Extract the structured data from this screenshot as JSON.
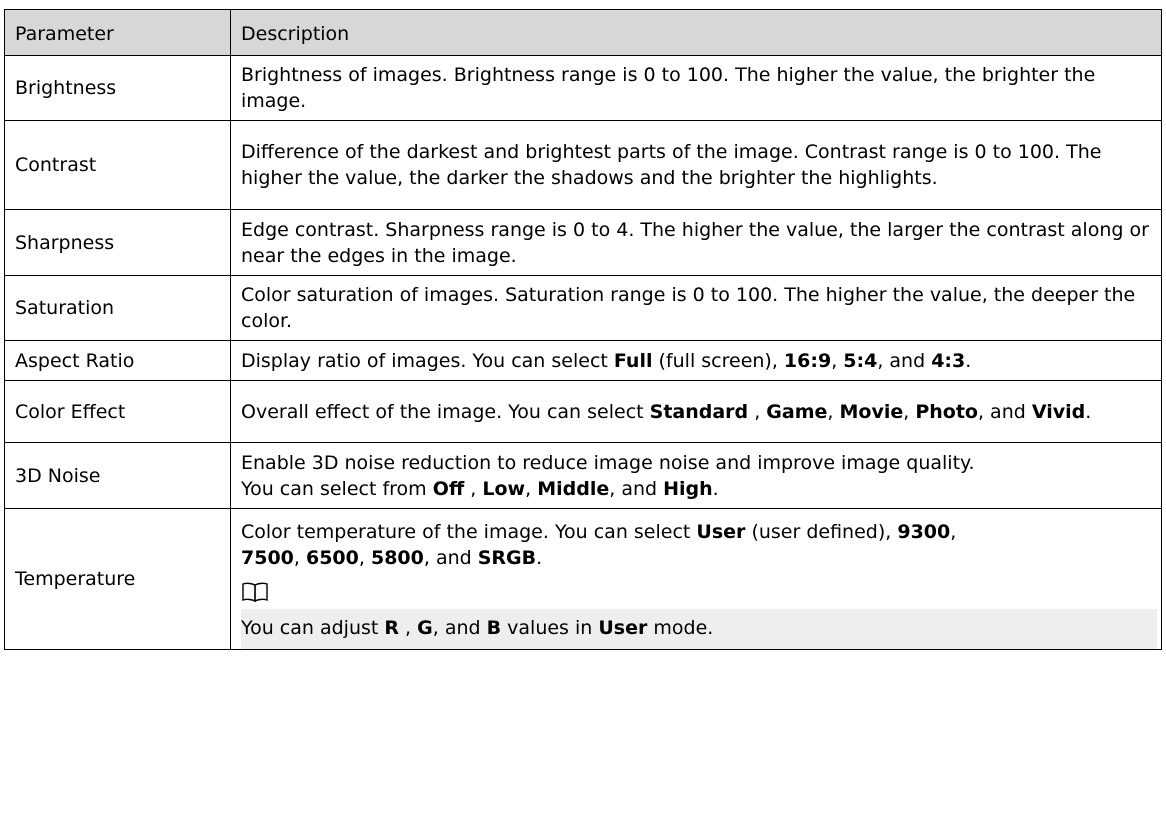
{
  "header": {
    "parameter": "Parameter",
    "description": "Description"
  },
  "rows": {
    "brightness": {
      "name": "Brightness",
      "desc": "Brightness of images. Brightness range is 0 to 100. The higher the value, the brighter the image."
    },
    "contrast": {
      "name": "Contrast",
      "desc": "Difference of the darkest and brightest parts of the image. Contrast range is 0 to 100. The higher the value, the darker the shadows and the brighter the highlights."
    },
    "sharpness": {
      "name": "Sharpness",
      "desc": "Edge contrast. Sharpness range is 0 to 4. The higher the value, the larger the contrast along or near the edges in the image."
    },
    "saturation": {
      "name": "Saturation",
      "desc": "Color saturation of images. Saturation range is 0 to 100. The higher the value, the deeper the color."
    },
    "aspect_ratio": {
      "name": "Aspect Ratio",
      "desc_prefix": "Display ratio of images. You can select ",
      "opt_full": "Full",
      "opt_full_note": " (full screen), ",
      "opt_169": "16:9",
      "sep1": ", ",
      "opt_54": "5:4",
      "sep2": ", and ",
      "opt_43": "4:3",
      "end": "."
    },
    "color_effect": {
      "name": "Color Effect",
      "desc_prefix": "Overall effect of the image. You can select ",
      "opt_standard": "Standard",
      "sep1": " , ",
      "opt_game": "Game",
      "sep2": ", ",
      "opt_movie": "Movie",
      "sep3": ", ",
      "opt_photo": "Photo",
      "sep4": ", and ",
      "opt_vivid": "Vivid",
      "end": "."
    },
    "noise_3d": {
      "name": "3D Noise",
      "desc_line1": "Enable 3D noise reduction to reduce image noise and improve image quality.",
      "desc_prefix": "You can select from ",
      "opt_off": "Off",
      "sep1": " , ",
      "opt_low": "Low",
      "sep2": ", ",
      "opt_middle": "Middle",
      "sep3": ", and ",
      "opt_high": "High",
      "end": "."
    },
    "temperature": {
      "name": "Temperature",
      "desc_prefix": "Color temperature of the image. You can select ",
      "opt_user": "User",
      "opt_user_note": " (user defined), ",
      "opt_9300": "9300",
      "sep1": ", ",
      "opt_7500": "7500",
      "sep2": ", ",
      "opt_6500": "6500",
      "sep3": ", ",
      "opt_5800": "5800",
      "sep4": ", and ",
      "opt_srgb": "SRGB",
      "end": ".",
      "note_icon": "book-icon",
      "note_prefix": "You can adjust ",
      "note_r": "R",
      "note_sep1": " , ",
      "note_g": "G",
      "note_sep2": ", and ",
      "note_b": "B",
      "note_mid": " values in ",
      "note_user": "User",
      "note_end": " mode."
    }
  }
}
